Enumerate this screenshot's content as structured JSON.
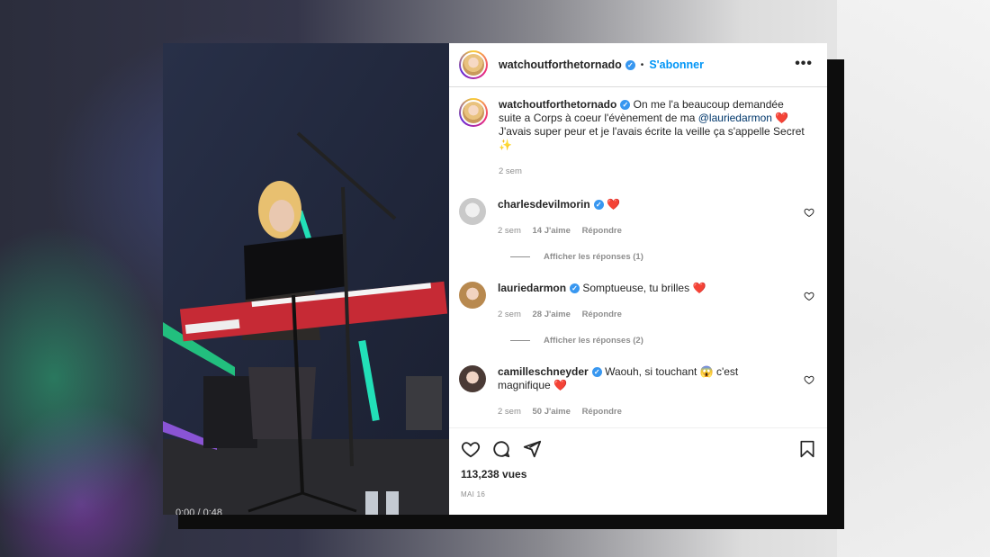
{
  "post": {
    "username": "watchoutforthetornado",
    "follow_label": "S'abonner",
    "more_label": "•••",
    "caption_before": "On me l'a beaucoup demandée suite a Corps à coeur l'évènement de ma ",
    "caption_mention": "@lauriedarmon",
    "caption_emoji": "❤️",
    "caption_after": "J'avais super peur et je l'avais écrite la veille ça s'appelle Secret",
    "caption_emoji2": "✨",
    "caption_time": "2 sem",
    "video_time": "0:00 / 0:48"
  },
  "comments": [
    {
      "username": "charlesdevilmorin",
      "text": "❤️",
      "time": "2 sem",
      "likes": "14 J'aime",
      "reply": "Répondre",
      "view_replies": "Afficher les réponses (1)"
    },
    {
      "username": "lauriedarmon",
      "text": "Somptueuse, tu brilles ❤️",
      "time": "2 sem",
      "likes": "28 J'aime",
      "reply": "Répondre",
      "view_replies": "Afficher les réponses (2)"
    },
    {
      "username": "camilleschneyder",
      "text": "Waouh, si touchant 😱 c'est magnifique ❤️",
      "time": "2 sem",
      "likes": "50 J'aime",
      "reply": "Répondre"
    }
  ],
  "stats": {
    "views": "113,238 vues",
    "date": "MAI 16"
  },
  "icons": [
    "heart-icon",
    "comment-icon",
    "share-icon",
    "bookmark-icon",
    "verified-icon",
    "more-icon"
  ],
  "colors": {
    "accent": "#0095f6",
    "verified": "#3897f0",
    "text": "#262626",
    "muted": "#8e8e8e"
  }
}
